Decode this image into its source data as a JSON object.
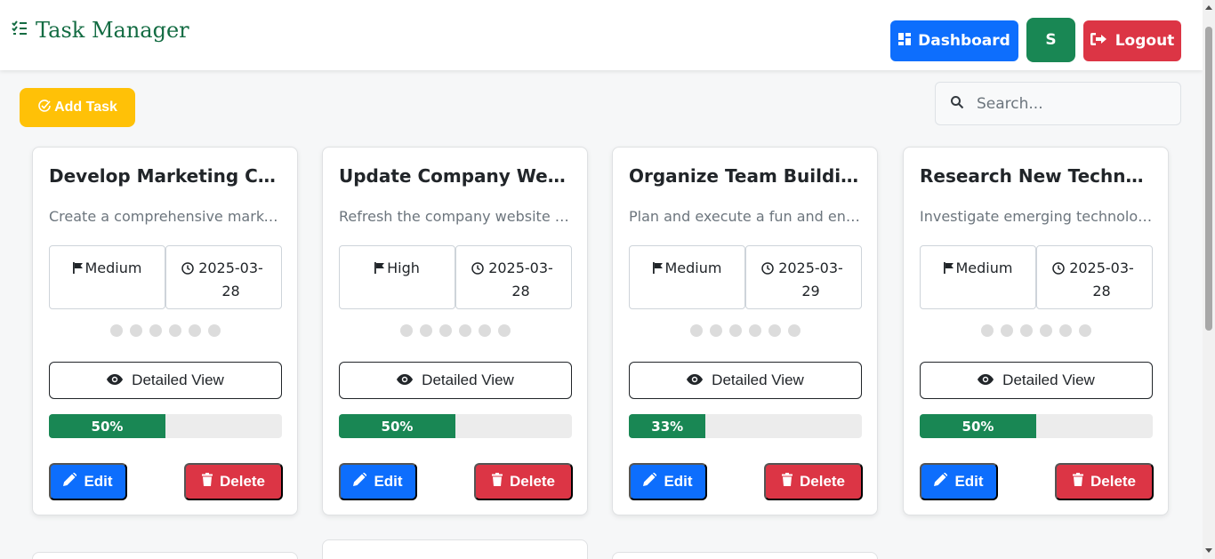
{
  "navbar": {
    "brand": "Task Manager",
    "brand_icon": "task-list-icon",
    "dashboard_label": "Dashboard",
    "avatar_initial": "S",
    "logout_label": "Logout"
  },
  "toolbar": {
    "add_task_label": "Add Task",
    "search_placeholder": "Search..."
  },
  "colors": {
    "primary": "#0d6efd",
    "success": "#198754",
    "danger": "#dc3545",
    "warning": "#ffc107",
    "brand": "#146c43"
  },
  "tasks": [
    {
      "title": "Develop Marketing Campaign",
      "description": "Create a comprehensive marketing campaign",
      "priority": "Medium",
      "due_date": "2025-03-28",
      "detail_label": "Detailed View",
      "progress_text": "50%",
      "progress": 0.5,
      "edit_label": "Edit",
      "delete_label": "Delete"
    },
    {
      "title": "Update Company Website",
      "description": "Refresh the company website with new content",
      "priority": "High",
      "due_date": "2025-03-28",
      "detail_label": "Detailed View",
      "progress_text": "50%",
      "progress": 0.5,
      "edit_label": "Edit",
      "delete_label": "Delete"
    },
    {
      "title": "Organize Team Building Event",
      "description": "Plan and execute a fun and engaging event",
      "priority": "Medium",
      "due_date": "2025-03-29",
      "detail_label": "Detailed View",
      "progress_text": "33%",
      "progress": 0.33,
      "edit_label": "Edit",
      "delete_label": "Delete"
    },
    {
      "title": "Research New Technologies",
      "description": "Investigate emerging technologies for adoption",
      "priority": "Medium",
      "due_date": "2025-03-28",
      "detail_label": "Detailed View",
      "progress_text": "50%",
      "progress": 0.5,
      "edit_label": "Edit",
      "delete_label": "Delete"
    }
  ]
}
